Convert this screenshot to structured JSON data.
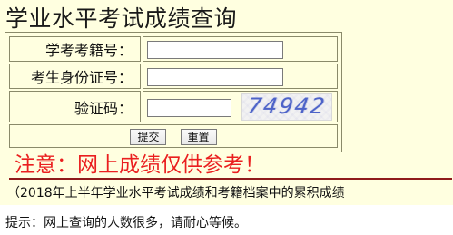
{
  "page": {
    "title": "学业水平考试成绩查询"
  },
  "form": {
    "student_id_label": "学考考籍号：",
    "student_id_value": "",
    "id_card_label": "考生身份证号：",
    "id_card_value": "",
    "captcha_label": "验证码：",
    "captcha_value": "",
    "captcha_image_text": "74942"
  },
  "buttons": {
    "submit_label": "提交",
    "reset_label": "重置"
  },
  "notice": {
    "text": "注意：网上成绩仅供参考！"
  },
  "footnote": {
    "text": "（2018年上半年学业水平考试成绩和考籍档案中的累积成绩"
  },
  "tip": {
    "text": "提示：网上查询的人数很多，请耐心等候。"
  },
  "colors": {
    "background": "#ffffe0",
    "warning_red": "#ea1f1f",
    "captcha_blue": "#4d63c8"
  }
}
